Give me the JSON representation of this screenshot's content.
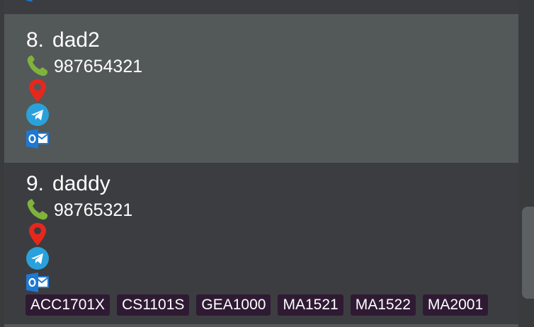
{
  "contacts": [
    {
      "index": "8.",
      "name": "dad2",
      "phone": "987654321",
      "icons": [
        "phone-icon",
        "location-pin-icon",
        "telegram-icon",
        "outlook-email-icon"
      ],
      "tags": []
    },
    {
      "index": "9.",
      "name": "daddy",
      "phone": "98765321",
      "icons": [
        "phone-icon",
        "location-pin-icon",
        "telegram-icon",
        "outlook-email-icon"
      ],
      "tags": [
        "ACC1701X",
        "CS1101S",
        "GEA1000",
        "MA1521",
        "MA1522",
        "MA2001"
      ]
    }
  ],
  "colors": {
    "selected_card": "#535859",
    "card": "#3c3d40",
    "tag_bg": "#2f1a33",
    "phone_green": "#7fb33c",
    "pin_red": "#e8271c",
    "telegram_blue": "#2aa1db",
    "outlook_blue": "#1f78d1"
  }
}
